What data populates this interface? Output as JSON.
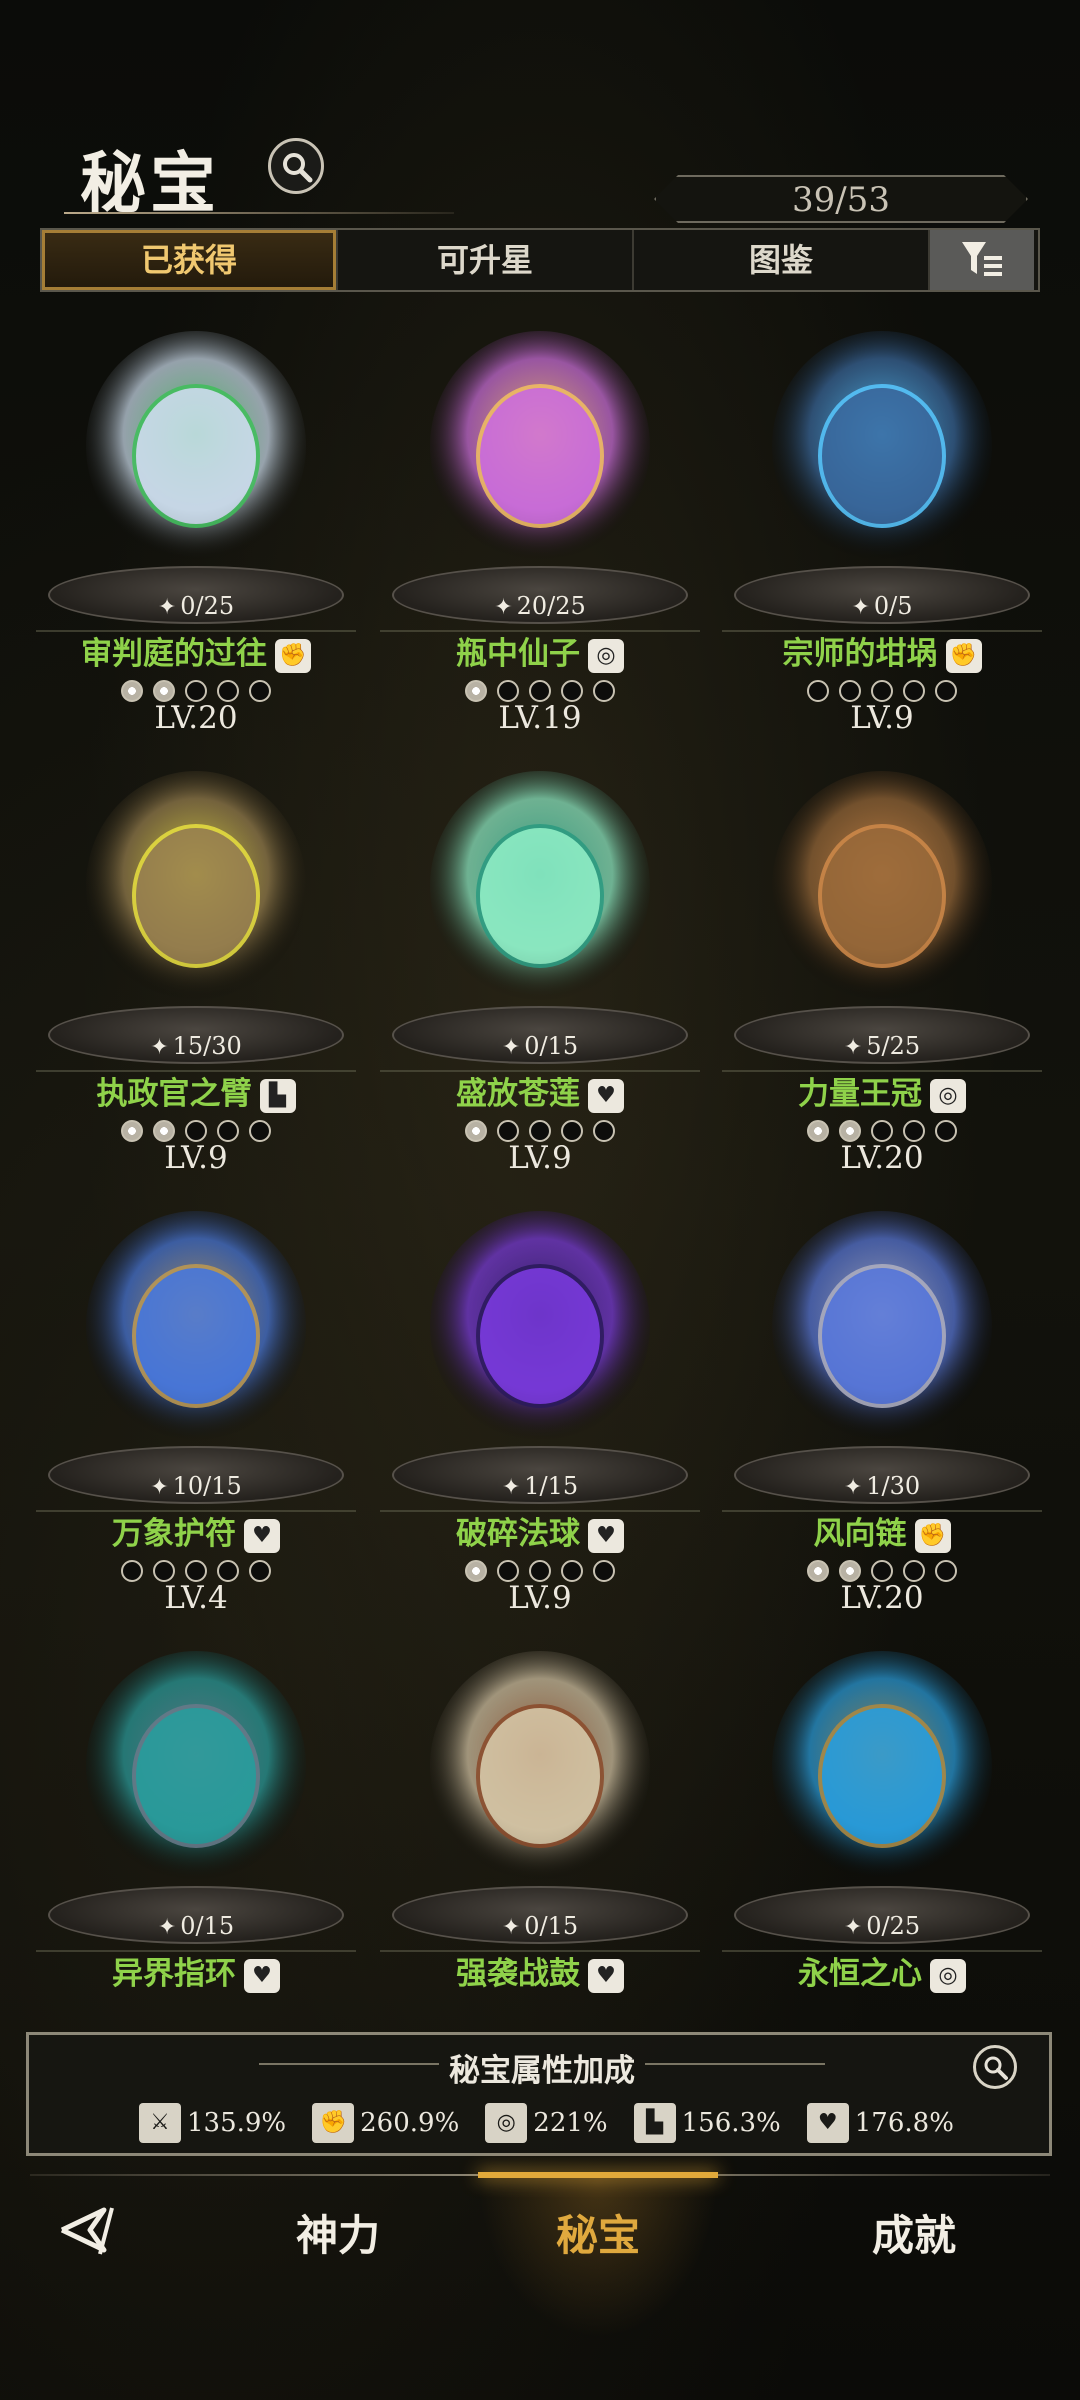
{
  "header": {
    "title": "秘宝",
    "counter": "39/53"
  },
  "tabs": [
    {
      "label": "已获得",
      "active": true
    },
    {
      "label": "可升星",
      "active": false
    },
    {
      "label": "图鉴",
      "active": false
    }
  ],
  "items": [
    {
      "name": "审判庭的过往",
      "shards": "0/25",
      "level": "LV.20",
      "stars_filled": 2,
      "type_icon": "fist-icon"
    },
    {
      "name": "瓶中仙子",
      "shards": "20/25",
      "level": "LV.19",
      "stars_filled": 1,
      "type_icon": "swirl-icon"
    },
    {
      "name": "宗师的坩埚",
      "shards": "0/5",
      "level": "LV.9",
      "stars_filled": 0,
      "type_icon": "fist-icon"
    },
    {
      "name": "执政官之臂",
      "shards": "15/30",
      "level": "LV.9",
      "stars_filled": 2,
      "type_icon": "boot-icon"
    },
    {
      "name": "盛放苍莲",
      "shards": "0/15",
      "level": "LV.9",
      "stars_filled": 1,
      "type_icon": "heart-icon"
    },
    {
      "name": "力量王冠",
      "shards": "5/25",
      "level": "LV.20",
      "stars_filled": 2,
      "type_icon": "swirl-icon"
    },
    {
      "name": "万象护符",
      "shards": "10/15",
      "level": "LV.4",
      "stars_filled": 0,
      "type_icon": "heart-icon"
    },
    {
      "name": "破碎法球",
      "shards": "1/15",
      "level": "LV.9",
      "stars_filled": 1,
      "type_icon": "heart-icon"
    },
    {
      "name": "风向链",
      "shards": "1/30",
      "level": "LV.20",
      "stars_filled": 2,
      "type_icon": "fist-icon"
    },
    {
      "name": "异界指环",
      "shards": "0/15",
      "level": "",
      "stars_filled": 0,
      "type_icon": "heart-icon"
    },
    {
      "name": "强袭战鼓",
      "shards": "0/15",
      "level": "",
      "stars_filled": 0,
      "type_icon": "heart-icon"
    },
    {
      "name": "永恒之心",
      "shards": "0/25",
      "level": "",
      "stars_filled": 0,
      "type_icon": "swirl-icon"
    }
  ],
  "bonus": {
    "title": "秘宝属性加成",
    "stats": [
      {
        "icon": "sword-icon",
        "value": "135.9%"
      },
      {
        "icon": "fist-icon",
        "value": "260.9%"
      },
      {
        "icon": "swirl-icon",
        "value": "221%"
      },
      {
        "icon": "boot-icon",
        "value": "156.3%"
      },
      {
        "icon": "heart-icon",
        "value": "176.8%"
      }
    ]
  },
  "nav": {
    "items": [
      "神力",
      "秘宝",
      "成就"
    ],
    "active": "秘宝"
  },
  "colors": {
    "item_name": "#8fd24a",
    "accent": "#e0a93e",
    "tab_active": "#f0c870"
  }
}
